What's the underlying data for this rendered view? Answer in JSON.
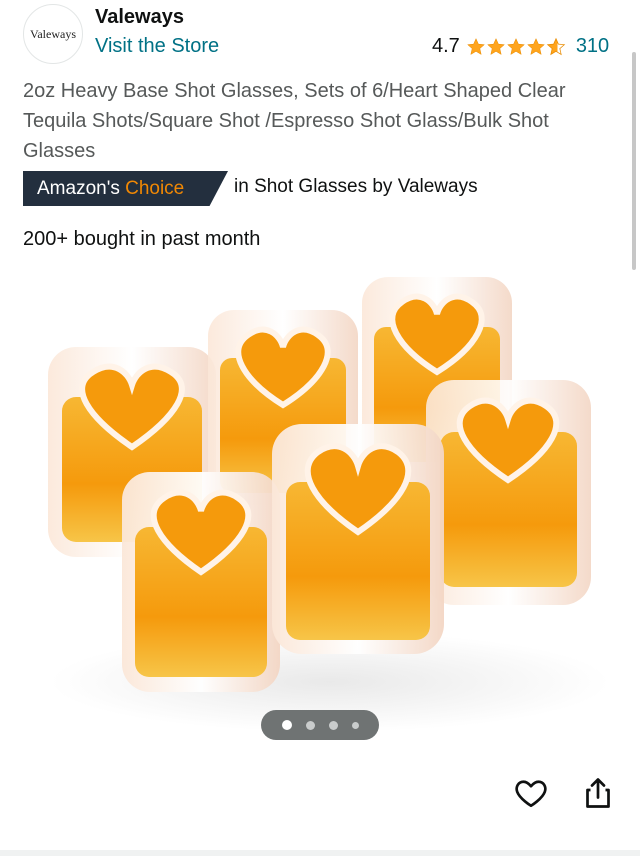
{
  "store": {
    "logo_text": "Valeways",
    "name": "Valeways",
    "visit_label": "Visit the Store"
  },
  "rating": {
    "value": "4.7",
    "stars": 4.7,
    "count": "310",
    "star_color": "#ffa41c"
  },
  "product": {
    "title": "2oz Heavy Base Shot Glasses, Sets of 6/Heart Shaped Clear Tequila Shots/Square Shot /Espresso Shot Glass/Bulk Shot Glasses",
    "bought_text": "200+ bought in past month"
  },
  "badge": {
    "prefix": "Amazon's",
    "highlight": "Choice",
    "category_text": "in Shot Glasses by Valeways"
  },
  "carousel": {
    "total_images": 4,
    "active_index": 0
  },
  "actions": {
    "favorite_icon": "heart-outline-icon",
    "share_icon": "share-icon"
  },
  "colors": {
    "link": "#007185",
    "badge_bg": "#232f3e",
    "badge_accent": "#f08804",
    "liquid": "#f5a20a"
  }
}
